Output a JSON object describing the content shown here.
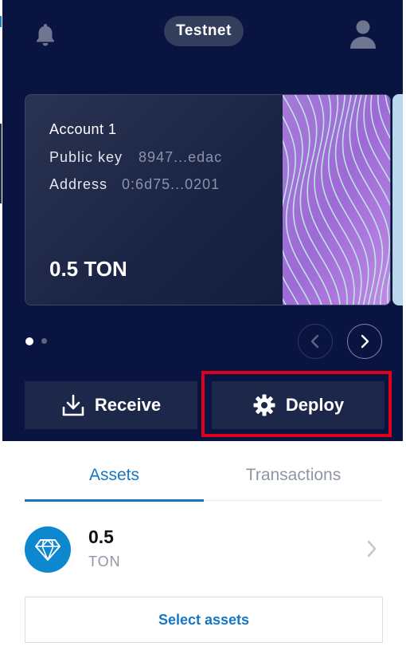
{
  "header": {
    "network": "Testnet",
    "icons": {
      "notifications": "bell-icon",
      "profile": "user-icon"
    }
  },
  "account": {
    "name": "Account 1",
    "public_key_label": "Public key",
    "public_key_value": "8947...edac",
    "address_label": "Address",
    "address_value": "0:6d75...0201",
    "balance": "0.5 TON"
  },
  "carousel": {
    "page_count": 2,
    "active_index": 0
  },
  "actions": {
    "receive_label": "Receive",
    "deploy_label": "Deploy"
  },
  "tabs": [
    {
      "label": "Assets",
      "active": true
    },
    {
      "label": "Transactions",
      "active": false
    }
  ],
  "assets": [
    {
      "amount": "0.5",
      "symbol": "TON",
      "icon": "diamond-icon"
    }
  ],
  "select_assets_label": "Select assets",
  "colors": {
    "hero_bg": "#091440",
    "accent": "#1477c6",
    "highlight": "#e0001a",
    "button_bg": "#1d274a"
  }
}
